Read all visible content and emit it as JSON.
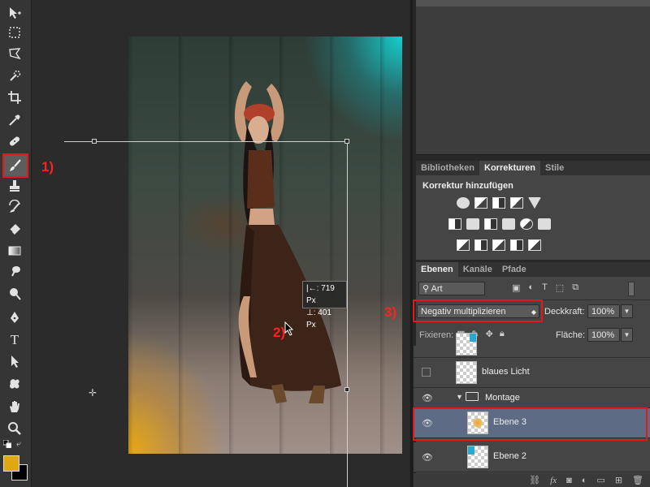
{
  "annotations": {
    "step1": "1)",
    "step2": "2)",
    "step3": "3)"
  },
  "measure": {
    "width_label": "|←: 719 Px",
    "height_label": "⊥: 401 Px"
  },
  "adjustments_panel": {
    "tabs": [
      "Bibliotheken",
      "Korrekturen",
      "Stile"
    ],
    "active_tab": "Korrekturen",
    "title": "Korrektur hinzufügen"
  },
  "layers_panel": {
    "tabs": [
      "Ebenen",
      "Kanäle",
      "Pfade"
    ],
    "active_tab": "Ebenen",
    "filter_label": "Art",
    "blend_mode": "Negativ multiplizieren",
    "opacity_label": "Deckkraft:",
    "opacity_value": "100%",
    "lock_label": "Fixieren:",
    "fill_label": "Fläche:",
    "fill_value": "100%",
    "layers": [
      {
        "name": "blaues Licht",
        "visible": false
      },
      {
        "name": "Montage",
        "visible": true,
        "group": true
      },
      {
        "name": "Ebene 3",
        "visible": true,
        "selected": true
      },
      {
        "name": "Ebene 2",
        "visible": true
      }
    ]
  },
  "colors": {
    "foreground": "#e0a810",
    "background": "#000000",
    "highlight": "#e01a1a",
    "selected_layer": "#5d6b85"
  },
  "icons": {
    "toolbar": [
      "move-icon",
      "marquee-icon",
      "lasso-icon",
      "quick-select-icon",
      "crop-icon",
      "eyedropper-icon",
      "healing-icon",
      "brush-icon",
      "stamp-icon",
      "history-brush-icon",
      "eraser-icon",
      "gradient-icon",
      "smudge-icon",
      "dodge-icon",
      "pen-icon",
      "type-icon",
      "path-select-icon",
      "shape-icon",
      "hand-icon",
      "zoom-icon"
    ]
  }
}
